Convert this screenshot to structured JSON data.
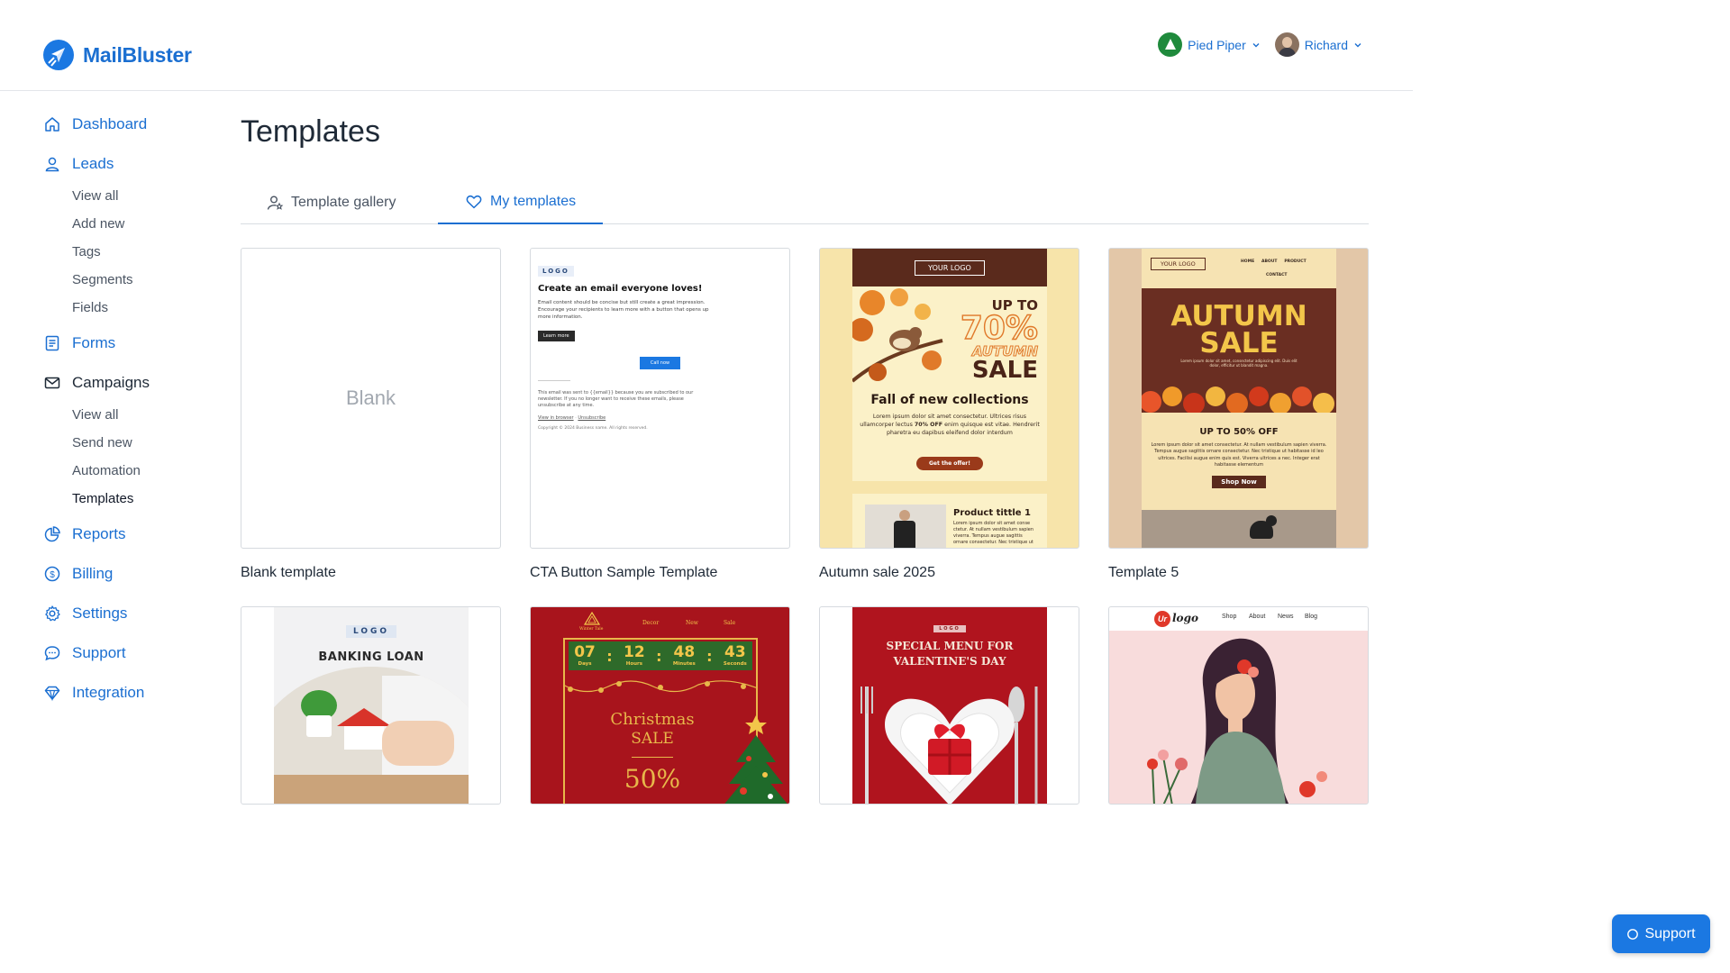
{
  "header": {
    "brand": "MailBluster",
    "workspace": "Pied Piper",
    "user": "Richard"
  },
  "sidebar": {
    "items": [
      {
        "label": "Dashboard",
        "icon": "home-icon"
      },
      {
        "label": "Leads",
        "icon": "user-icon",
        "children": [
          "View all",
          "Add new",
          "Tags",
          "Segments",
          "Fields"
        ]
      },
      {
        "label": "Forms",
        "icon": "form-icon"
      },
      {
        "label": "Campaigns",
        "icon": "mail-icon",
        "children": [
          "View all",
          "Send new",
          "Automation",
          "Templates"
        ]
      },
      {
        "label": "Reports",
        "icon": "pie-chart-icon"
      },
      {
        "label": "Billing",
        "icon": "dollar-icon"
      },
      {
        "label": "Settings",
        "icon": "gear-icon"
      },
      {
        "label": "Support",
        "icon": "chat-icon"
      },
      {
        "label": "Integration",
        "icon": "diamond-icon"
      }
    ]
  },
  "main": {
    "title": "Templates",
    "tabs": [
      {
        "label": "Template gallery",
        "icon": "user-star-icon"
      },
      {
        "label": "My templates",
        "icon": "heart-icon"
      }
    ],
    "templates": [
      {
        "name": "Blank template",
        "placeholder": "Blank"
      },
      {
        "name": "CTA Button Sample Template"
      },
      {
        "name": "Autumn sale 2025"
      },
      {
        "name": "Template 5"
      }
    ],
    "previews": {
      "cta": {
        "logo": "LOGO",
        "heading": "Create an email everyone loves!",
        "body": "Email content should be concise but still create a great impression. Encourage your recipients to learn more with a button that opens up more information.",
        "learn_more": "Learn more",
        "call_now": "Call now",
        "footer": "This email was sent to {{email}} because you are subscribed to our newsletter. If you no longer want to receive these emails, please unsubscribe at any time.",
        "view_browser": "View in browser",
        "unsubscribe": "Unsubscribe",
        "copyright": "Copyright © 2024 Business name. All rights reserved."
      },
      "autumn": {
        "logo": "YOUR LOGO",
        "upto": "UP TO",
        "pct": "70%",
        "word": "AUTUMN",
        "sale": "SALE",
        "headline": "Fall of new collections",
        "body_pre": "Lorem ipsum dolor sit amet consectetur. Ultrices risus ullamcorper lectus ",
        "body_bold": "70% OFF",
        "body_post": " enim quisque est vitae. Hendrerit pharetra eu dapibus eleifend dolor interdum",
        "cta": "Get the offer!",
        "product": "Product tittle 1",
        "product_body": "Lorem ipsum dolor sit amet conse ctetur. At nullam vestibulum sapien viverra. Tempus augue sagittis ornare consectetur. Nec tristique ut"
      },
      "t5": {
        "logo": "YOUR LOGO",
        "nav": [
          "HOME",
          "ABOUT",
          "PRODUCT",
          "CONTACT"
        ],
        "title1": "AUTUMN",
        "title2": "SALE",
        "tiny": "Lorem ipsum dolor sit amet, consectetur adipiscing elit. Duis elit dolor, efficitur ut blandit magna.",
        "offer": "UP TO 50% OFF",
        "body": "Lorem ipsum dolor sit amet consectetur. At nullam vestibulum sapien viverra. Tempus augue sagittis ornare consectetur. Nec tristique ut habitasse id leo ultrices. Facilisi augue enim quis est. Viverra ultrices a nec. Integer erat habitasse elementum",
        "shop": "Shop Now"
      },
      "bank": {
        "logo": "LOGO",
        "title": "BANKING LOAN"
      },
      "xmas": {
        "brand": "Winter Tale",
        "nav": [
          "Decor",
          "New",
          "Sale"
        ],
        "timer": [
          {
            "value": "07",
            "unit": "Days"
          },
          {
            "value": "12",
            "unit": "Hours"
          },
          {
            "value": "48",
            "unit": "Minutes"
          },
          {
            "value": "43",
            "unit": "Seconds"
          }
        ],
        "title1": "Christmas",
        "title2": "SALE",
        "pct": "50%"
      },
      "valentine": {
        "logo": "LOGO",
        "title": "SPECIAL MENU FOR VALENTINE'S DAY"
      },
      "urlogo": {
        "brand_ur": "Ur",
        "brand_logo": "logo",
        "nav": [
          "Shop",
          "About",
          "News",
          "Blog"
        ]
      }
    }
  },
  "support_button": "Support",
  "colors": {
    "accent": "#1b78e2",
    "link": "#1b6fd1"
  }
}
